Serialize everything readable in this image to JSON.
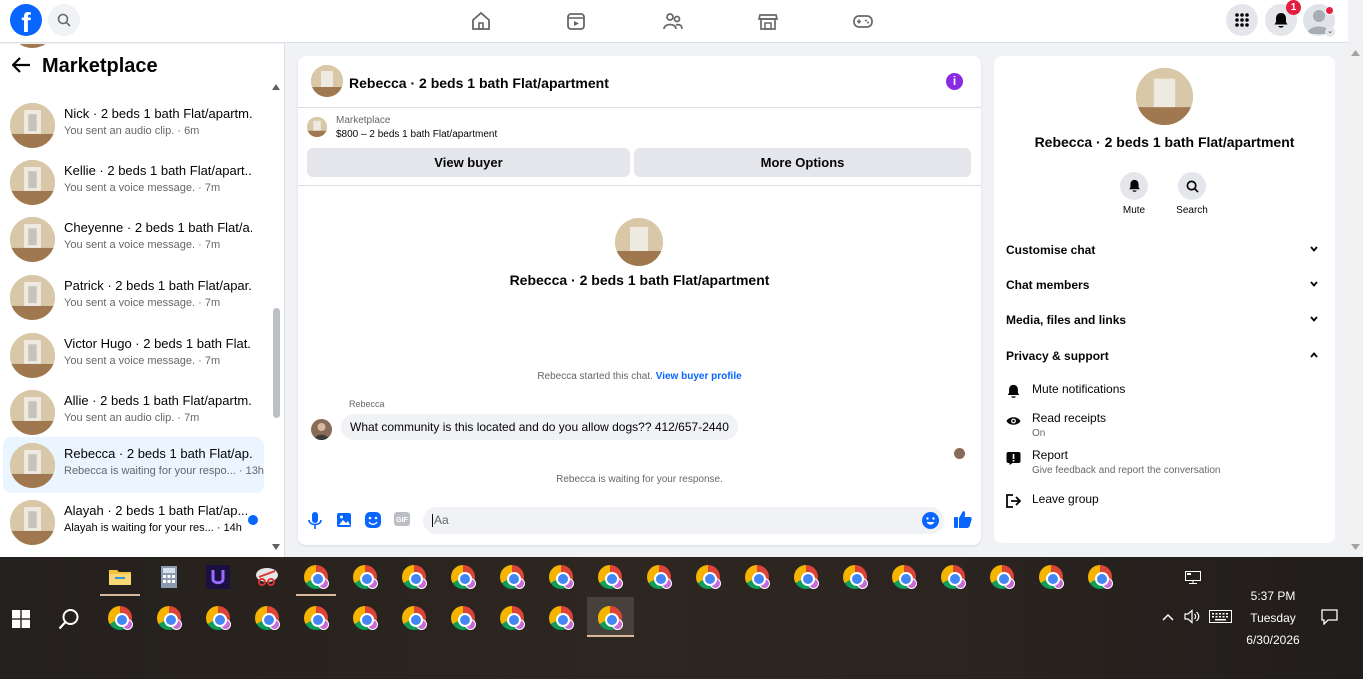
{
  "topbar": {
    "logo": "f",
    "notification_count": "1",
    "icons": [
      "search-icon",
      "home-icon",
      "video-icon",
      "groups-icon",
      "marketplace-icon",
      "gaming-icon",
      "menu-grid-icon",
      "bell-icon"
    ]
  },
  "sidebar": {
    "title": "Marketplace",
    "conversations": [
      {
        "name": "Nick · 2 beds 1 bath Flat/apartm...",
        "snippet": "You sent an audio clip. · 6m"
      },
      {
        "name": "Kellie · 2 beds 1 bath Flat/apart...",
        "snippet": "You sent a voice message. · 7m"
      },
      {
        "name": "Cheyenne · 2 beds 1 bath Flat/a...",
        "snippet": "You sent a voice message. · 7m"
      },
      {
        "name": "Patrick · 2 beds 1 bath Flat/apar...",
        "snippet": "You sent a voice message. · 7m"
      },
      {
        "name": "Victor Hugo · 2 beds 1 bath Flat...",
        "snippet": "You sent a voice message. · 7m"
      },
      {
        "name": "Allie · 2 beds 1 bath Flat/apartm...",
        "snippet": "You sent an audio clip. · 7m"
      },
      {
        "name": "Rebecca · 2 beds 1 bath Flat/ap...",
        "snippet": "Rebecca is waiting for your respo... · 13h"
      },
      {
        "name": "Alayah · 2 beds 1 bath Flat/ap...",
        "snippet": "Alayah is waiting for your res... · 14h"
      }
    ]
  },
  "chat": {
    "title": "Rebecca · 2 beds 1 bath Flat/apartment",
    "marketplace_label": "Marketplace",
    "listing": "$800 – 2 beds 1 bath Flat/apartment",
    "view_buyer": "View buyer",
    "more_options": "More Options",
    "intro_name": "Rebecca · 2 beds 1 bath Flat/apartment",
    "started_text": "Rebecca started this chat.",
    "view_profile": "View buyer profile",
    "sender": "Rebecca",
    "message": "What community is this located and do you allow dogs?? 412/657-2440",
    "waiting": "Rebecca is waiting for your response.",
    "input_placeholder": "Aa"
  },
  "details": {
    "name": "Rebecca · 2 beds 1 bath Flat/apartment",
    "mute_label": "Mute",
    "search_label": "Search",
    "sections": [
      "Customise chat",
      "Chat members",
      "Media, files and links",
      "Privacy & support"
    ],
    "mute_notifications": "Mute notifications",
    "read_receipts": "Read receipts",
    "read_receipts_state": "On",
    "report": "Report",
    "report_desc": "Give feedback and report the conversation",
    "leave_group": "Leave group"
  },
  "taskbar": {
    "time": "5:37 PM",
    "day": "Tuesday",
    "date": "6/30/2026"
  },
  "colors": {
    "accent": "#0866ff",
    "badge": "#e41e3f",
    "info": "#8a2be2"
  }
}
